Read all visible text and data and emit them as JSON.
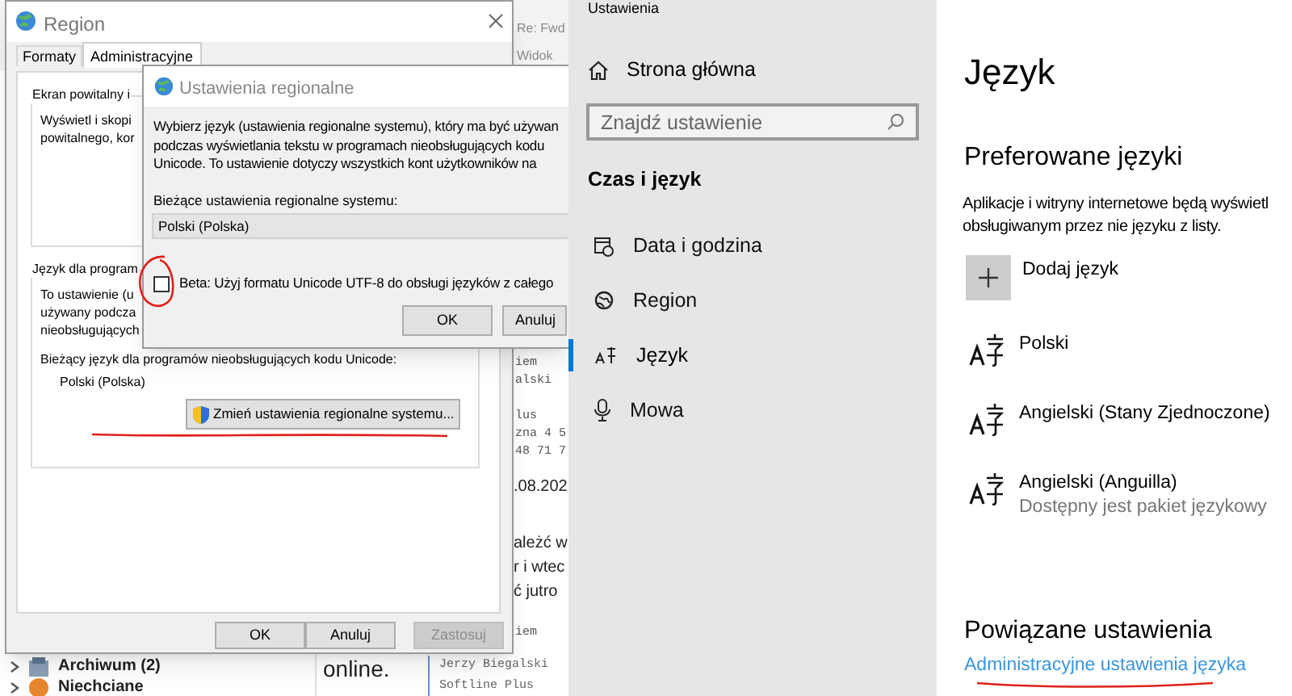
{
  "mail_window": {
    "header": [
      "Re: Fwd",
      "Widok"
    ],
    "body_lines": [
      {
        "text": "iem",
        "kind": "mono"
      },
      {
        "text": "alski",
        "kind": "mono"
      },
      {
        "text": "lus",
        "kind": "mono"
      },
      {
        "text": "zna 4 5",
        "kind": "mono"
      },
      {
        "text": "48 71 7",
        "kind": "mono"
      },
      {
        "text": ".08.202",
        "kind": "prose"
      },
      {
        "text": "ależć w",
        "kind": "prose"
      },
      {
        "text": "r i wtec",
        "kind": "prose"
      },
      {
        "text": "ć jutro",
        "kind": "prose"
      },
      {
        "text": "iem",
        "kind": "mono"
      }
    ],
    "online_text": "online.",
    "signature_lines": [
      "Jerzy Biegalski",
      "Softline Plus"
    ],
    "folders": [
      {
        "label": "Archiwum (2)"
      },
      {
        "label": "Niechciane"
      }
    ]
  },
  "region_dialog": {
    "title": "Region",
    "tabs": [
      {
        "label": "Formaty",
        "selected": false
      },
      {
        "label": "Administracyjne",
        "selected": true
      }
    ],
    "welcome_group": {
      "title": "Ekran powitalny i",
      "lines": [
        "Wyświetl i skopi",
        "powitalnego, kor"
      ]
    },
    "language_group": {
      "title": "Język dla program",
      "lines": [
        "To ustawienie (u",
        "używany podcza",
        "nieobsługujących"
      ],
      "current_label": "Bieżący język dla programów nieobsługujących kodu Unicode:",
      "current_value": "Polski (Polska)",
      "change_button": "Zmień ustawienia regionalne systemu..."
    },
    "buttons": [
      {
        "label": "OK",
        "disabled": false
      },
      {
        "label": "Anuluj",
        "disabled": false
      },
      {
        "label": "Zastosuj",
        "disabled": true
      }
    ]
  },
  "regional_dialog": {
    "title": "Ustawienia regionalne",
    "description": [
      "Wybierz język (ustawienia regionalne systemu), który ma być używan",
      "podczas wyświetlania tekstu w programach nieobsługujących kodu",
      "Unicode. To ustawienie dotyczy wszystkich kont użytkowników na"
    ],
    "current_label": "Bieżące ustawienia regionalne systemu:",
    "current_value": "Polski (Polska)",
    "checkbox": {
      "label": "Beta: Użyj formatu Unicode UTF-8 do obsługi języków z całego",
      "checked": false
    },
    "buttons": [
      "OK",
      "Anuluj"
    ]
  },
  "settings": {
    "app_title": "Ustawienia",
    "home": "Strona główna",
    "search": {
      "placeholder": "Znajdź ustawienie"
    },
    "section": "Czas i język",
    "nav": [
      {
        "label": "Data i godzina",
        "selected": false
      },
      {
        "label": "Region",
        "selected": false
      },
      {
        "label": "Język",
        "selected": true
      },
      {
        "label": "Mowa",
        "selected": false
      }
    ],
    "page_title": "Język",
    "preferred_title": "Preferowane języki",
    "preferred_description": [
      "Aplikacje i witryny internetowe będą wyświetl",
      "obsługiwanym przez nie języku z listy."
    ],
    "add_language": "Dodaj język",
    "languages": [
      {
        "name": "Polski"
      },
      {
        "name": "Angielski (Stany Zjednoczone)"
      },
      {
        "name": "Angielski (Anguilla)",
        "status": "Dostępny jest pakiet językowy"
      }
    ],
    "related_title": "Powiązane ustawienia",
    "related_link": "Administracyjne ustawienia języka"
  }
}
